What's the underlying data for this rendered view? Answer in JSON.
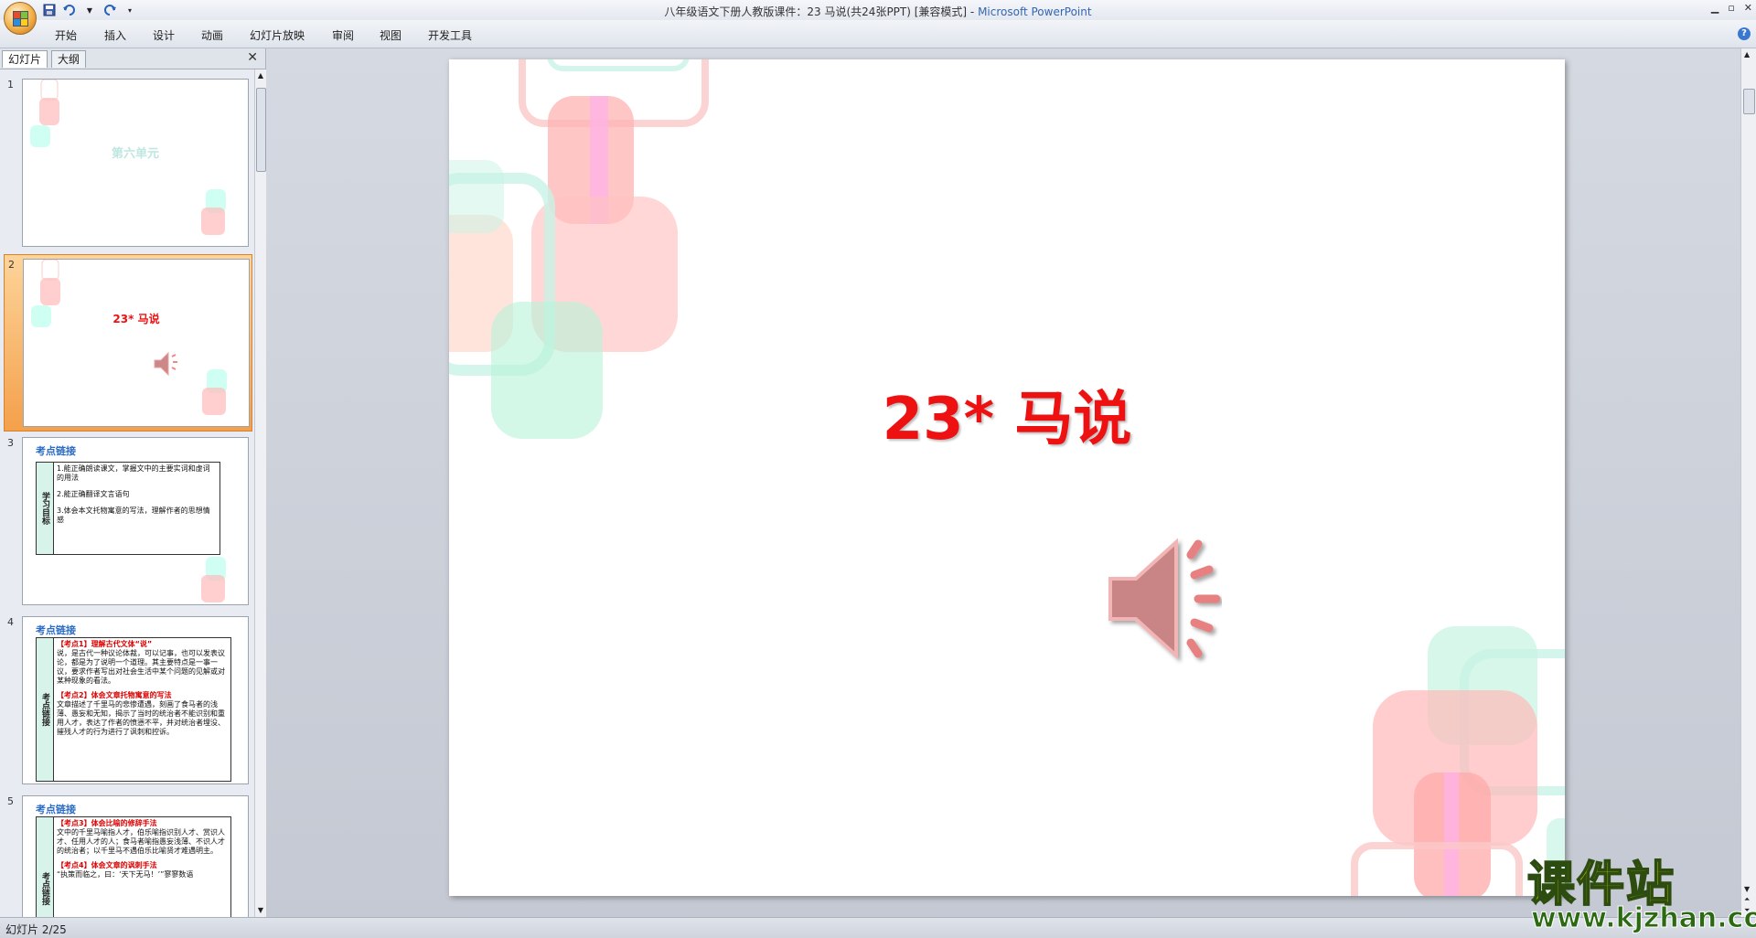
{
  "window": {
    "title": "八年级语文下册人教版课件：23 马说(共24张PPT) [兼容模式]",
    "app_name": "Microsoft PowerPoint",
    "separator": " - "
  },
  "ribbon": {
    "tabs": [
      "开始",
      "插入",
      "设计",
      "动画",
      "幻灯片放映",
      "审阅",
      "视图",
      "开发工具"
    ]
  },
  "panel": {
    "tab_slides": "幻灯片",
    "tab_outline": "大纲"
  },
  "thumbnails": [
    {
      "num": "1",
      "title": "第六单元"
    },
    {
      "num": "2",
      "title": "23*  马说"
    },
    {
      "num": "3",
      "heading": "考点链接",
      "side": "学习目标",
      "lines": [
        "1.能正确朗读课文，掌握文中的主要实词和虚词的用法",
        "2.能正确翻译文言语句",
        "3.体会本文托物寓意的写法，理解作者的思想情感"
      ]
    },
    {
      "num": "4",
      "heading": "考点链接",
      "side": "考点链接",
      "lines_red": [
        "【考点1】理解古代文体“说”",
        "【考点2】体会文章托物寓意的写法"
      ],
      "lines": [
        "说，是古代一种议论体裁，可以记事，也可以发表议论，都是为了说明一个道理。其主要特点是一事一议，要求作者写出对社会生活中某个问题的见解或对某种现象的看法。",
        "文章描述了千里马的悲惨遭遇，刻画了食马者的浅薄、愚妄和无知，揭示了当时的统治者不能识别和重用人才，表达了作者的愤懑不平，并对统治者埋没、摧残人才的行为进行了讽刺和控诉。"
      ]
    },
    {
      "num": "5",
      "heading": "考点链接",
      "side": "考点链接",
      "lines_red": [
        "【考点3】体会比喻的修辞手法",
        "【考点4】体会文章的讽刺手法"
      ],
      "lines": [
        "文中的千里马喻指人才，伯乐喻指识别人才、赏识人才、任用人才的人；食马者喻指愚妄浅薄、不识人才的统治者；以千里马不遇伯乐比喻贤才难遇明主。",
        "“执策而临之，曰：‘天下无马！’”寥寥数语"
      ]
    }
  ],
  "slide": {
    "title": "23*  马说"
  },
  "status": {
    "text": "幻灯片 2/25"
  },
  "watermark": {
    "title": "课件站",
    "url": "www.kjzhan.com"
  },
  "colors": {
    "title_red": "#ee1111",
    "heading_blue": "#2a6bc4",
    "selected_thumb": "#f4a04b"
  }
}
